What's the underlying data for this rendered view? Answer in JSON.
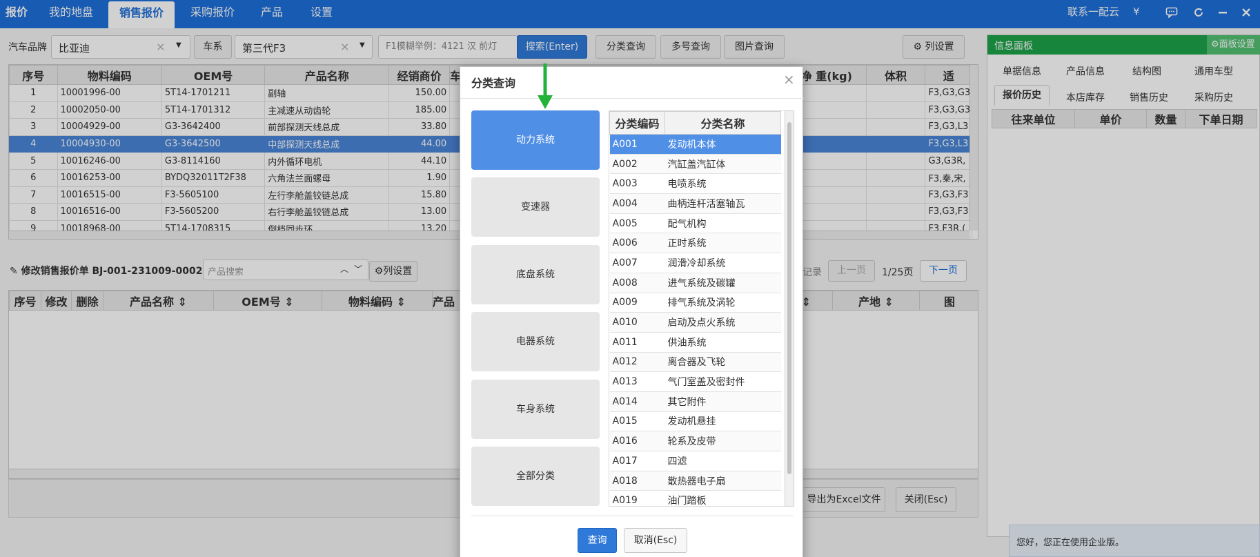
{
  "topbar": {
    "app_title": "报价",
    "nav": [
      "我的地盘",
      "销售报价",
      "采购报价",
      "产品",
      "设置"
    ],
    "active_nav": "销售报价",
    "contact": "联系一配云",
    "yen_icon": "¥"
  },
  "filters": {
    "brand_label": "汽车品牌",
    "brand_value": "比亚迪",
    "series_button": "车系",
    "series_value": "第三代F3",
    "search_placeholder": "F1模糊举例：4121 汉 前灯",
    "search_button": "搜索(Enter)",
    "category_query": "分类查询",
    "multi_query": "多号查询",
    "image_query": "图片查询",
    "column_settings": "列设置"
  },
  "product_grid": {
    "headers": [
      "序号",
      "物料编码",
      "OEM号",
      "产品名称",
      "经销商价",
      "车",
      "净 重(kg)",
      "体积",
      "适"
    ],
    "rows": [
      {
        "no": "1",
        "code": "10001996-00",
        "oem": "5T14-1701211",
        "name": "副轴",
        "price": "150.00",
        "fit": "F3,G3,G3"
      },
      {
        "no": "2",
        "code": "10002050-00",
        "oem": "5T14-1701312",
        "name": "主减速从动齿轮",
        "price": "185.00",
        "fit": "F3,G3,G3"
      },
      {
        "no": "3",
        "code": "10004929-00",
        "oem": "G3-3642400",
        "name": "前部探测天线总成",
        "price": "33.80",
        "fit": "F3,G3,L3"
      },
      {
        "no": "4",
        "code": "10004930-00",
        "oem": "G3-3642500",
        "name": "中部探测天线总成",
        "price": "44.00",
        "fit": "F3,G3,L3"
      },
      {
        "no": "5",
        "code": "10016246-00",
        "oem": "G3-8114160",
        "name": "内外循环电机",
        "price": "44.10",
        "fit": "G3,G3R,"
      },
      {
        "no": "6",
        "code": "10016253-00",
        "oem": "BYDQ32011T2F38",
        "name": "六角法兰面螺母",
        "price": "1.90",
        "fit": "F3,秦,宋,"
      },
      {
        "no": "7",
        "code": "10016515-00",
        "oem": "F3-5605100",
        "name": "左行李舱盖铰链总成",
        "price": "15.80",
        "fit": "F3,G3,F3"
      },
      {
        "no": "8",
        "code": "10016516-00",
        "oem": "F3-5605200",
        "name": "右行李舱盖铰链总成",
        "price": "13.00",
        "fit": "F3,G3,F3"
      },
      {
        "no": "9",
        "code": "10018968-00",
        "oem": "5T14-1708315",
        "name": "倒档同步环",
        "price": "13.20",
        "fit": "F3,F3R,("
      }
    ]
  },
  "quote_section": {
    "title": "修改销售报价单 BJ-001-231009-0002",
    "product_search_placeholder": "产品搜索",
    "column_settings": "列设置",
    "records": "记录",
    "prev_page": "上一页",
    "page_info": "1/25页",
    "next_page": "下一页",
    "headers": [
      "序号",
      "修改",
      "删除",
      "产品名称 ⇕",
      "OEM号 ⇕",
      "物料编码 ⇕",
      "产品",
      "牌 ⇕",
      "产地 ⇕",
      "图"
    ],
    "export_excel": "导出为Excel文件",
    "close": "关闭(Esc)"
  },
  "info_panel": {
    "title": "信息面板",
    "settings": "面板设置",
    "tabs_row1": [
      "单据信息",
      "产品信息",
      "结构图",
      "通用车型"
    ],
    "tabs_row2": [
      "报价历史",
      "本店库存",
      "销售历史",
      "采购历史"
    ],
    "active_tab": "报价历史",
    "history_headers": [
      "往来单位",
      "单价",
      "数量",
      "下单日期"
    ],
    "footer_text": "您好，您正在使用企业版。"
  },
  "modal": {
    "title": "分类查询",
    "close_icon": "×",
    "categories": [
      "动力系统",
      "变速器",
      "底盘系统",
      "电器系统",
      "车身系统",
      "全部分类"
    ],
    "active_category": "动力系统",
    "table_headers": [
      "分类编码",
      "分类名称"
    ],
    "rows": [
      {
        "code": "A001",
        "name": "发动机本体"
      },
      {
        "code": "A002",
        "name": "汽缸盖汽缸体"
      },
      {
        "code": "A003",
        "name": "电喷系统"
      },
      {
        "code": "A004",
        "name": "曲柄连杆活塞轴瓦"
      },
      {
        "code": "A005",
        "name": "配气机构"
      },
      {
        "code": "A006",
        "name": "正时系统"
      },
      {
        "code": "A007",
        "name": "润滑冷却系统"
      },
      {
        "code": "A008",
        "name": "进气系统及碳罐"
      },
      {
        "code": "A009",
        "name": "排气系统及涡轮"
      },
      {
        "code": "A010",
        "name": "启动及点火系统"
      },
      {
        "code": "A011",
        "name": "供油系统"
      },
      {
        "code": "A012",
        "name": "离合器及飞轮"
      },
      {
        "code": "A013",
        "name": "气门室盖及密封件"
      },
      {
        "code": "A014",
        "name": "其它附件"
      },
      {
        "code": "A015",
        "name": "发动机悬挂"
      },
      {
        "code": "A016",
        "name": "轮系及皮带"
      },
      {
        "code": "A017",
        "name": "四滤"
      },
      {
        "code": "A018",
        "name": "散热器电子扇"
      },
      {
        "code": "A019",
        "name": "油门踏板"
      }
    ],
    "selected_code": "A001",
    "query_button": "查询",
    "cancel_button": "取消(Esc)"
  },
  "colors": {
    "topbar": "#1e6fd9",
    "primary": "#2f7ad9",
    "selection": "#4f8fe6",
    "panel_header": "#1ea34a",
    "arrow": "#21b33a"
  }
}
